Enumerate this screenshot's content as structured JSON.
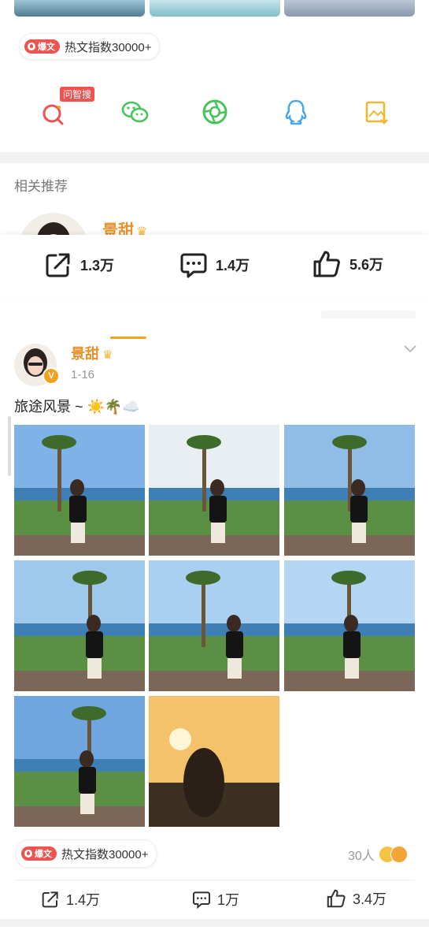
{
  "hot_badge": {
    "label": "爆文",
    "text": "热文指数30000+"
  },
  "share_row": {
    "wenzhisou_tag": "问智搜",
    "icons": [
      "wenzhisou-search-icon",
      "wechat-icon",
      "moments-icon",
      "qq-icon",
      "save-image-icon"
    ]
  },
  "related": {
    "title": "相关推荐",
    "user_name": "景甜"
  },
  "stats_bar": {
    "repost": "1.3万",
    "comment": "1.4万",
    "like": "5.6万"
  },
  "post": {
    "user_name": "景甜",
    "date": "1-16",
    "text": "旅途风景 ~ ☀️🌴☁️",
    "photo_count": 8,
    "hot_badge": {
      "label": "爆文",
      "text": "热文指数30000+"
    },
    "reactions_count": "30人",
    "actions": {
      "repost": "1.4万",
      "comment": "1万",
      "like": "3.4万"
    }
  },
  "colors": {
    "accent_red": "#ef5350",
    "brand_orange": "#f4a21d",
    "green": "#46c35a",
    "blue_qq": "#4aa8e8",
    "gold": "#f2b632"
  }
}
